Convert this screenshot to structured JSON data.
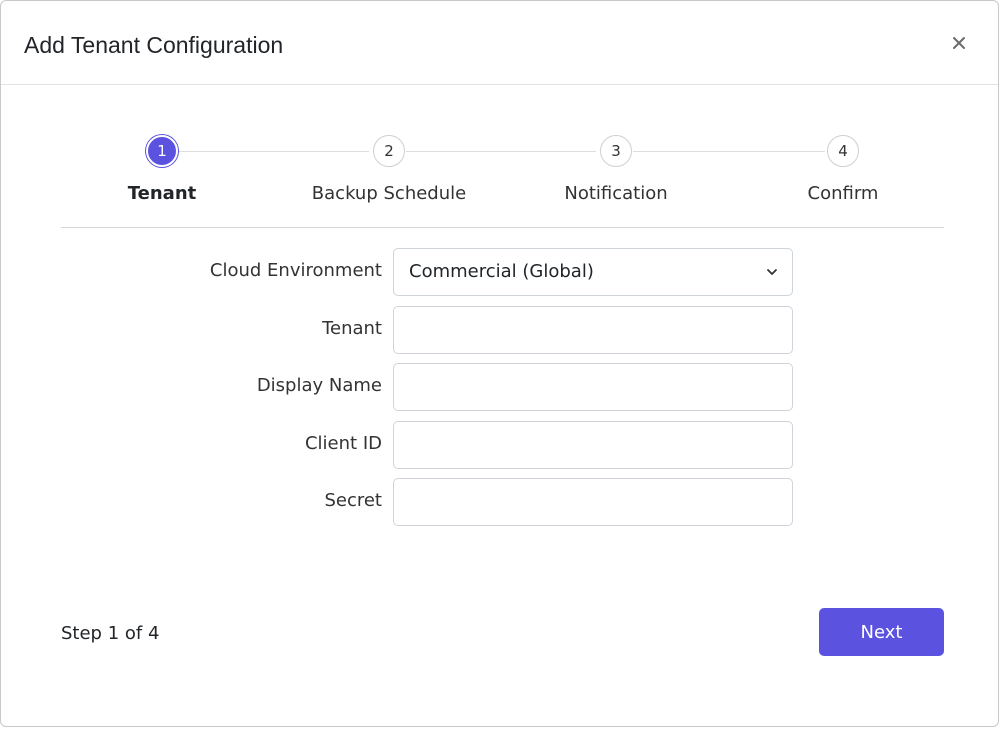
{
  "modal": {
    "title": "Add Tenant Configuration",
    "close_icon": "close-icon"
  },
  "stepper": {
    "steps": [
      {
        "number": "1",
        "label": "Tenant",
        "active": true
      },
      {
        "number": "2",
        "label": "Backup Schedule",
        "active": false
      },
      {
        "number": "3",
        "label": "Notification",
        "active": false
      },
      {
        "number": "4",
        "label": "Confirm",
        "active": false
      }
    ],
    "accent_color": "#5b52e0"
  },
  "form": {
    "cloud_environment": {
      "label": "Cloud Environment",
      "value": "Commercial (Global)",
      "icon": "chevron-down-icon"
    },
    "tenant": {
      "label": "Tenant",
      "value": ""
    },
    "display_name": {
      "label": "Display Name",
      "value": ""
    },
    "client_id": {
      "label": "Client ID",
      "value": ""
    },
    "secret": {
      "label": "Secret",
      "value": ""
    }
  },
  "footer": {
    "step_indicator": "Step 1 of 4",
    "next_label": "Next"
  }
}
